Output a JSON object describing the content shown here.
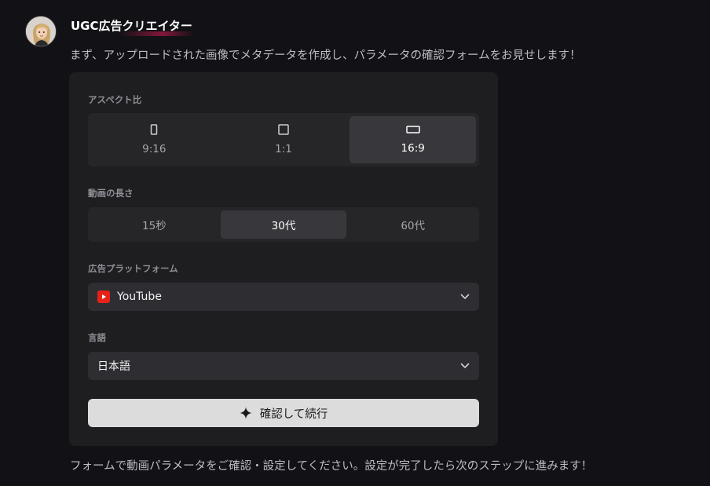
{
  "message": {
    "author": "UGC広告クリエイター",
    "avatar_icon": "woman-waving-avatar",
    "intro": "まず、アップロードされた画像でメタデータを作成し、パラメータの確認フォームをお見せします！",
    "footer": "フォームで動画パラメータをご確認・設定してください。設定が完了したら次のステップに進みます！"
  },
  "form": {
    "aspect": {
      "label": "アスペクト比",
      "options": [
        {
          "label": "9:16",
          "icon": "portrait-rect-icon"
        },
        {
          "label": "1:1",
          "icon": "square-icon"
        },
        {
          "label": "16:9",
          "icon": "landscape-rect-icon"
        }
      ],
      "selected": "16:9"
    },
    "duration": {
      "label": "動画の長さ",
      "options": [
        "15秒",
        "30代",
        "60代"
      ],
      "selected": "30代"
    },
    "platform": {
      "label": "広告プラットフォーム",
      "value": "YouTube",
      "icon": "youtube-icon"
    },
    "language": {
      "label": "言語",
      "value": "日本語"
    },
    "confirm_label": "確認して続行"
  },
  "colors": {
    "background": "#121115",
    "card": "#1e1e21",
    "button": "#dcdcdc",
    "youtube_red": "#e62117"
  }
}
